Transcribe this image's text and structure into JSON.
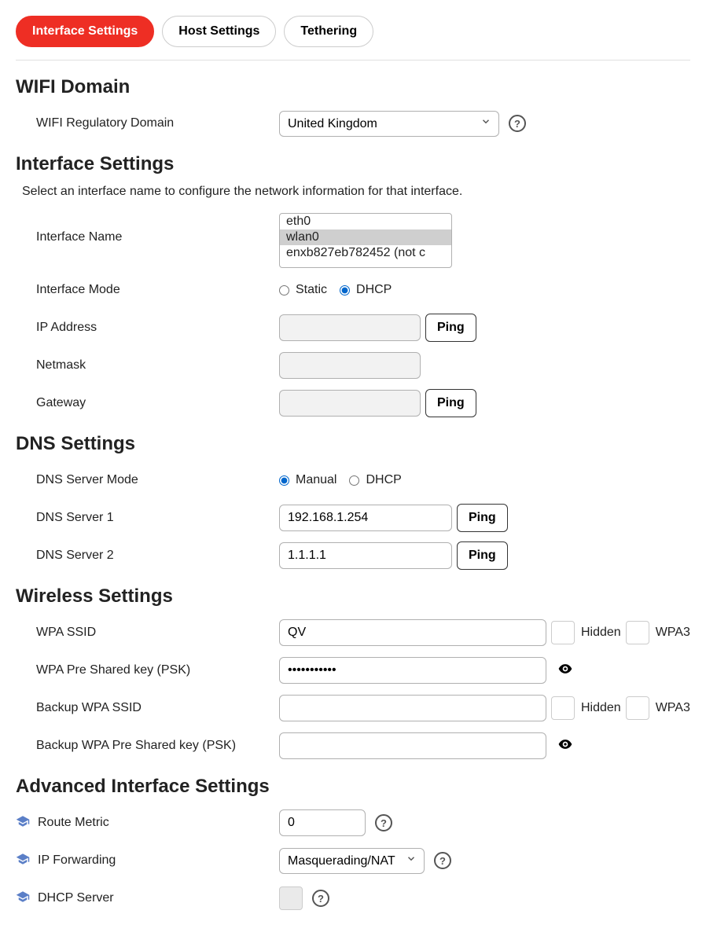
{
  "tabs": [
    {
      "label": "Interface Settings",
      "active": true
    },
    {
      "label": "Host Settings",
      "active": false
    },
    {
      "label": "Tethering",
      "active": false
    }
  ],
  "wifi_domain": {
    "heading": "WIFI Domain",
    "label": "WIFI Regulatory Domain",
    "value": "United Kingdom"
  },
  "interface_settings": {
    "heading": "Interface Settings",
    "desc": "Select an interface name to configure the network information for that interface.",
    "name_label": "Interface Name",
    "interfaces": [
      "eth0",
      "wlan0",
      "enxb827eb782452 (not c"
    ],
    "selected_interface": "wlan0",
    "mode_label": "Interface Mode",
    "mode_static": "Static",
    "mode_dhcp": "DHCP",
    "mode_value": "DHCP",
    "ip_label": "IP Address",
    "ip_value": "",
    "netmask_label": "Netmask",
    "netmask_value": "",
    "gateway_label": "Gateway",
    "gateway_value": "",
    "ping": "Ping"
  },
  "dns": {
    "heading": "DNS Settings",
    "mode_label": "DNS Server Mode",
    "mode_manual": "Manual",
    "mode_dhcp": "DHCP",
    "mode_value": "Manual",
    "s1_label": "DNS Server 1",
    "s1_value": "192.168.1.254",
    "s2_label": "DNS Server 2",
    "s2_value": "1.1.1.1",
    "ping": "Ping"
  },
  "wireless": {
    "heading": "Wireless Settings",
    "ssid_label": "WPA SSID",
    "ssid_value": "QV",
    "psk_label": "WPA Pre Shared key (PSK)",
    "psk_value": "•••••••••••",
    "backup_ssid_label": "Backup WPA SSID",
    "backup_ssid_value": "",
    "backup_psk_label": "Backup WPA Pre Shared key (PSK)",
    "backup_psk_value": "",
    "hidden": "Hidden",
    "wpa3": "WPA3"
  },
  "advanced": {
    "heading": "Advanced Interface Settings",
    "route_label": "Route Metric",
    "route_value": "0",
    "ipfwd_label": "IP Forwarding",
    "ipfwd_value": "Masquerading/NAT",
    "dhcp_label": "DHCP Server"
  }
}
